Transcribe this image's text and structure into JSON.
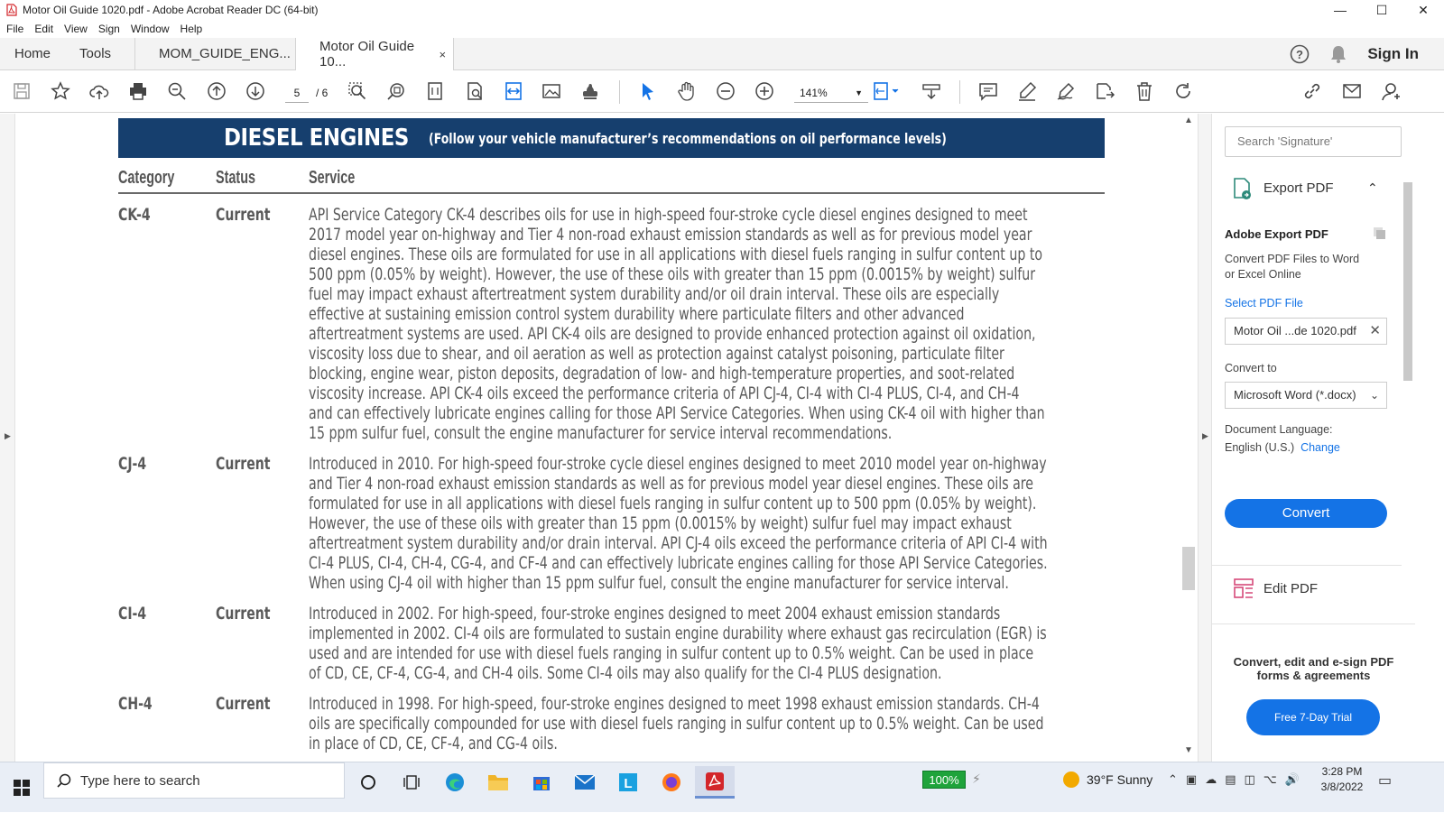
{
  "window": {
    "title": "Motor Oil Guide 1020.pdf - Adobe Acrobat Reader DC (64-bit)",
    "minimize": "—",
    "maximize": "☐",
    "close": "✕"
  },
  "menu": [
    "File",
    "Edit",
    "View",
    "Sign",
    "Window",
    "Help"
  ],
  "tabs": {
    "home": "Home",
    "tools": "Tools",
    "doc1": "MOM_GUIDE_ENG...",
    "doc2": "Motor Oil Guide 10...",
    "doc2_close": "×",
    "sign_in": "Sign In"
  },
  "toolbar": {
    "page_current": "5",
    "page_total": "/ 6",
    "zoom": "141%"
  },
  "document": {
    "banner_title": "DIESEL ENGINES",
    "banner_subtitle": "(Follow your vehicle manufacturer’s recommendations on oil performance levels)",
    "headers": {
      "category": "Category",
      "status": "Status",
      "service": "Service"
    },
    "rows": [
      {
        "category": "CK-4",
        "status": "Current",
        "lines": [
          "API Service Category CK-4 describes oils for use in high-speed four-stroke cycle diesel engines designed to meet",
          "2017 model year on-highway and Tier 4 non-road exhaust emission standards as well as for previous model year",
          "diesel engines. These oils are formulated for use in all applications with diesel fuels ranging in sulfur content up to",
          "500 ppm (0.05% by weight). However, the use of these oils with greater than 15 ppm (0.0015% by weight) sulfur",
          "fuel may impact exhaust aftertreatment system durability and/or oil drain interval. These oils are especially",
          "effective at sustaining emission control system durability where particulate filters and other advanced",
          "aftertreatment systems are used. API CK-4 oils are designed to provide enhanced protection against oil oxidation,",
          "viscosity loss due to shear, and oil aeration as well as  protection against catalyst poisoning, particulate filter",
          "blocking, engine wear, piston deposits, degradation of low- and high-temperature properties, and soot-related",
          "viscosity increase. API CK-4 oils exceed the performance criteria of API CJ-4, CI-4 with CI-4 PLUS, CI-4, and CH-4",
          "and can effectively lubricate engines calling for those API Service Categories. When using CK-4 oil with higher than",
          "15 ppm sulfur fuel, consult the engine manufacturer for service interval recommendations."
        ]
      },
      {
        "category": "CJ-4",
        "status": "Current",
        "lines": [
          "Introduced in 2010. For high-speed four-stroke cycle diesel engines designed to meet 2010 model year on-highway",
          "and Tier 4 non-road exhaust emission standards as well as for previous model year diesel engines. These oils are",
          "formulated for use in all applications with diesel fuels ranging in sulfur content up to 500 ppm (0.05% by weight).",
          "However, the use of these oils with greater than 15 ppm (0.0015% by weight) sulfur fuel may impact exhaust",
          "aftertreatment system durability and/or drain interval. API CJ-4 oils exceed the performance criteria of API CI-4 with",
          "CI-4 PLUS, CI-4, CH-4, CG-4, and CF-4 and can effectively lubricate engines calling for those API Service Categories.",
          "When using CJ-4 oil with higher than 15 ppm sulfur fuel, consult the engine manufacturer for service interval."
        ]
      },
      {
        "category": "CI-4",
        "status": "Current",
        "lines": [
          "Introduced in 2002. For high-speed, four-stroke engines designed to meet 2004 exhaust emission standards",
          "implemented in 2002. CI-4 oils are formulated to sustain engine durability where exhaust gas recirculation (EGR) is",
          "used and are intended for use with diesel fuels ranging in sulfur content up to 0.5% weight. Can be used in place",
          "of CD, CE, CF-4, CG-4, and CH-4 oils. Some CI-4 oils may also qualify for the CI-4 PLUS designation."
        ]
      },
      {
        "category": "CH-4",
        "status": "Current",
        "lines": [
          "Introduced in 1998. For high-speed, four-stroke engines designed to meet 1998 exhaust emission standards. CH-4",
          "oils are specifically compounded for use with diesel fuels ranging in sulfur content up to 0.5% weight. Can be used",
          "in place of CD, CE, CF-4, and CG-4 oils."
        ]
      }
    ]
  },
  "right_panel": {
    "search_placeholder": "Search 'Signature'",
    "export_title": "Export PDF",
    "adobe_export": "Adobe Export PDF",
    "convert_desc_1": "Convert PDF Files to Word",
    "convert_desc_2": "or Excel Online",
    "select_file": "Select PDF File",
    "file_name": "Motor Oil ...de 1020.pdf",
    "convert_to": "Convert to",
    "format": "Microsoft Word (*.docx)",
    "doc_lang_label": "Document Language:",
    "doc_lang": "English (U.S.)",
    "change": "Change",
    "convert_btn": "Convert",
    "edit_pdf": "Edit PDF",
    "promo_1": "Convert, edit and e-sign PDF",
    "promo_2": "forms & agreements",
    "trial": "Free 7-Day Trial"
  },
  "taskbar": {
    "search_placeholder": "Type here to search",
    "battery": "100%",
    "weather": "39°F  Sunny",
    "time": "3:28 PM",
    "date": "3/8/2022"
  },
  "colors": {
    "banner": "#163f6e",
    "accent": "#1473e6",
    "battery": "#1fa33b"
  }
}
